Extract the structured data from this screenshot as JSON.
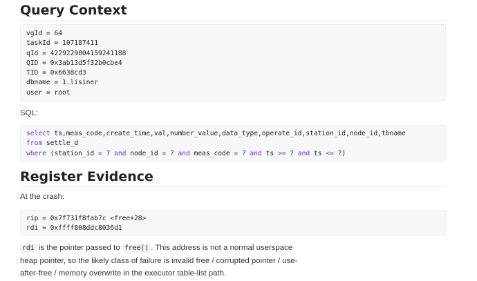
{
  "query_context": {
    "heading": "Query Context",
    "lines": [
      "vgId = 64",
      "taskId = 107187411",
      "qId = 4229229004159241188",
      "QID = 0x3ab13d5f32b0cbe4",
      "TID = 0x6638cd3",
      "dbname = 1.lisiner",
      "user = root"
    ]
  },
  "sql": {
    "label": "SQL:",
    "line1": {
      "kw": "select",
      "rest": " ts,meas_code,create_time,val,number_value,data_type,operate_id,station_id,node_id,tbname"
    },
    "line2": {
      "kw": "from",
      "rest": " settle_d"
    },
    "line3": {
      "kw": "where",
      "parts": [
        " (station_id ",
        "=",
        " ? ",
        "and",
        " node_id ",
        "=",
        " ? ",
        "and",
        " meas_code ",
        "=",
        " ? ",
        "and",
        " ts ",
        ">=",
        " ? ",
        "and",
        " ts ",
        "<=",
        " ?)"
      ]
    }
  },
  "register_evidence": {
    "heading": "Register Evidence",
    "intro": "At the crash:",
    "lines": [
      "rip = 0x7f731f8fab7c <free+28>",
      "rdi = 0xffff808ddc8036d1"
    ],
    "desc": {
      "code1": "rdi",
      "t1": " is the pointer passed to ",
      "code2": "free()",
      "t2": ". This address is not a normal userspace heap pointer, so the likely class of failure is invalid free / corrupted pointer / use-after-free / memory overwrite in the executor table-list path."
    }
  }
}
